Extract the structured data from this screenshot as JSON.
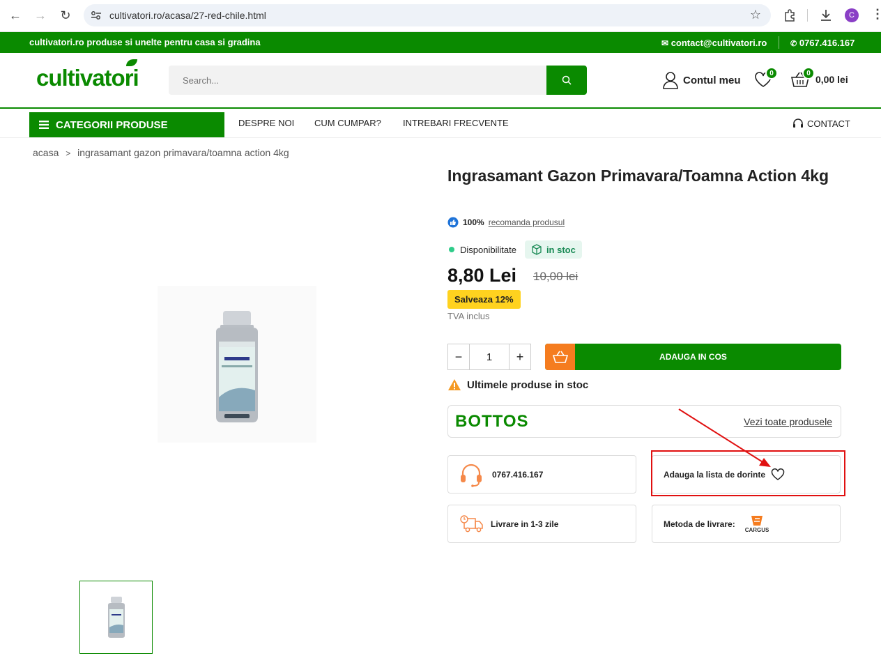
{
  "browser": {
    "url": "cultivatori.ro/acasa/27-red-chile.html",
    "profile_initial": "C"
  },
  "topbar": {
    "tagline": "cultivatori.ro produse si unelte pentru casa si gradina",
    "email": "contact@cultivatori.ro",
    "phone": "0767.416.167"
  },
  "header": {
    "logo": "cultivatori",
    "search_placeholder": "Search...",
    "account_label": "Contul meu",
    "wishlist_count": "0",
    "cart_count": "0",
    "cart_total": "0,00 lei"
  },
  "nav": {
    "categories": "CATEGORII PRODUSE",
    "links": [
      "DESPRE NOI",
      "CUM CUMPAR?",
      "INTREBARI FRECVENTE"
    ],
    "contact": "CONTACT"
  },
  "breadcrumb": {
    "home": "acasa",
    "separator": ">",
    "current": "ingrasamant gazon primavara/toamna action 4kg"
  },
  "product": {
    "title": "Ingrasamant Gazon Primavara/Toamna Action 4kg",
    "recommend_pct": "100%",
    "recommend_text": "recomanda produsul",
    "availability_label": "Disponibilitate",
    "stock_label": "in stoc",
    "price": "8,80 Lei",
    "old_price": "10,00 lei",
    "save_label": "Salveaza 12%",
    "tva": "TVA inclus",
    "quantity": "1",
    "add_to_cart": "ADAUGA IN COS",
    "last_stock": "Ultimele produse in stoc",
    "brand": "BOTTOS",
    "brand_link": "Vezi toate produsele",
    "phone": "0767.416.167",
    "wishlist_label": "Adauga la lista de dorinte",
    "delivery_time": "Livrare in 1-3 zile",
    "delivery_method": "Metoda de livrare:",
    "courier": "CARGUS"
  },
  "colors": {
    "brand_green": "#0a8a00",
    "accent_orange": "#f57c1f",
    "save_yellow": "#ffd21f",
    "highlight_red": "#e01010"
  }
}
